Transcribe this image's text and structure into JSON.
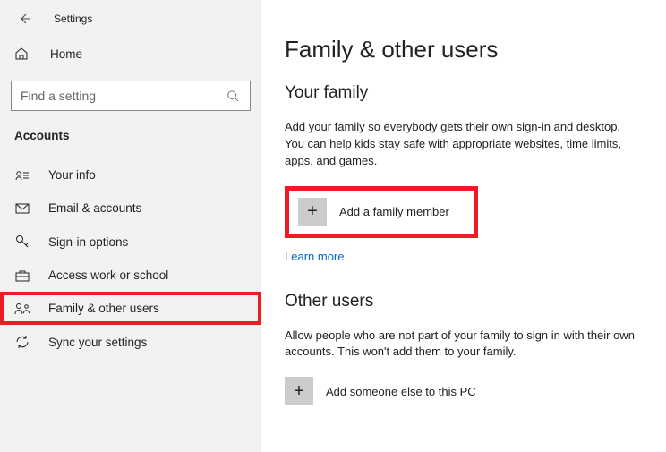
{
  "titlebar": {
    "title": "Settings"
  },
  "home": {
    "label": "Home"
  },
  "search": {
    "placeholder": "Find a setting"
  },
  "sectionHeader": "Accounts",
  "nav": {
    "items": [
      {
        "label": "Your info"
      },
      {
        "label": "Email & accounts"
      },
      {
        "label": "Sign-in options"
      },
      {
        "label": "Access work or school"
      },
      {
        "label": "Family & other users"
      },
      {
        "label": "Sync your settings"
      }
    ]
  },
  "main": {
    "heading": "Family & other users",
    "family": {
      "title": "Your family",
      "text": "Add your family so everybody gets their own sign-in and desktop. You can help kids stay safe with appropriate websites, time limits, apps, and games.",
      "addLabel": "Add a family member",
      "learnMore": "Learn more"
    },
    "other": {
      "title": "Other users",
      "text": "Allow people who are not part of your family to sign in with their own accounts. This won't add them to your family.",
      "addLabel": "Add someone else to this PC"
    }
  }
}
